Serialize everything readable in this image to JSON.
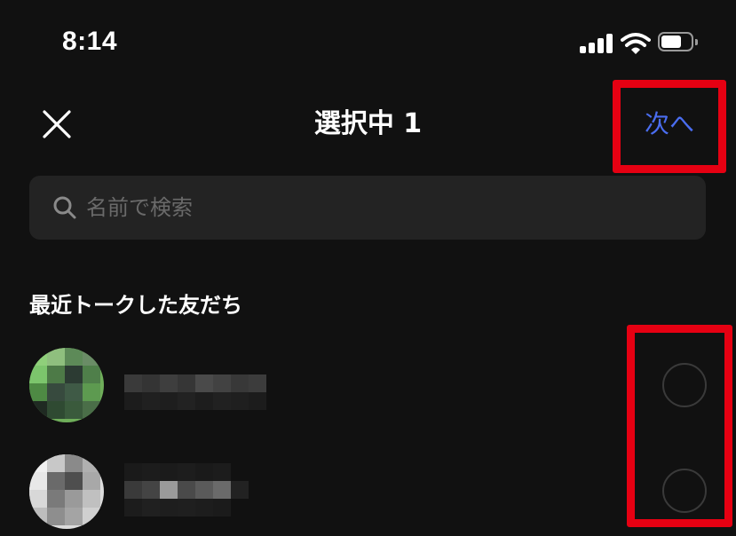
{
  "status_bar": {
    "time": "8:14",
    "icons": [
      "cellular-signal-icon",
      "wifi-icon",
      "battery-icon"
    ]
  },
  "header": {
    "close_icon": "close-icon",
    "title": "選択中 1",
    "next_label": "次へ"
  },
  "search": {
    "icon": "search-icon",
    "placeholder": "名前で検索",
    "value": ""
  },
  "section": {
    "title": "最近トークした友だち"
  },
  "friends": [
    {
      "name": "",
      "avatar": "avatar-pixelated",
      "selected": false
    },
    {
      "name": "",
      "avatar": "avatar-pixelated",
      "selected": false
    }
  ],
  "colors": {
    "background": "#111111",
    "accent": "#4a6df0",
    "highlight_annotation": "#e60012",
    "search_background": "#232323",
    "placeholder": "#6a6a6a"
  }
}
